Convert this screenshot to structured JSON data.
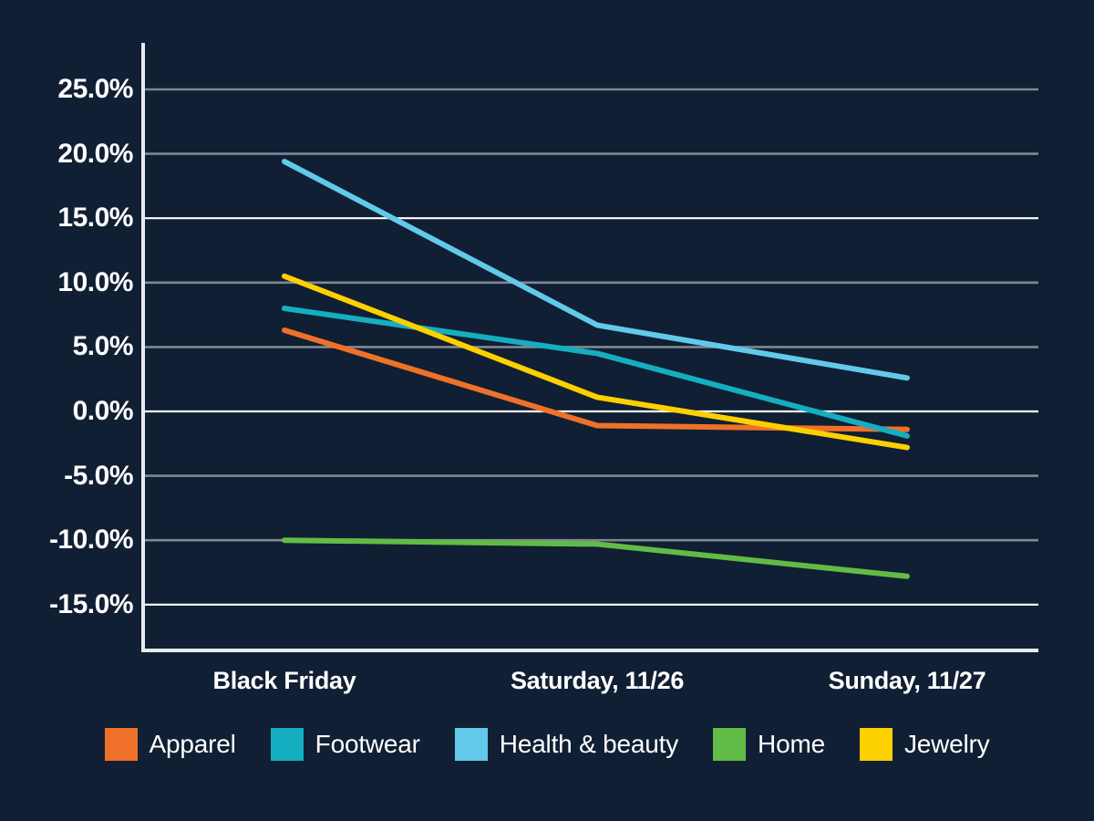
{
  "background_color": "#101f33",
  "axis": {
    "spine_color": "#e8eaed",
    "gridline_color": "#7e8893",
    "gridline_color_major": "#ffffff",
    "tick_text_color": "#ffffff"
  },
  "chart_data": {
    "type": "line",
    "title": "",
    "subtitle": "",
    "xlabel": "",
    "ylabel": "",
    "categories": [
      "Black Friday",
      "Saturday, 11/26",
      "Sunday, 11/27"
    ],
    "ylim": [
      -17.5,
      27.0
    ],
    "yticks": [
      25.0,
      20.0,
      15.0,
      10.0,
      5.0,
      0.0,
      -5.0,
      -10.0,
      -15.0
    ],
    "ytick_labels": [
      "25.0%",
      "20.0%",
      "15.0%",
      "10.0%",
      "5.0%",
      "0.0%",
      "-5.0%",
      "-10.0%",
      "-15.0%"
    ],
    "grid": true,
    "grid_axis": "y",
    "legend_position": "bottom",
    "value_format": "percent",
    "series": [
      {
        "name": "Apparel",
        "color": "#ef7129",
        "values": [
          6.3,
          -1.1,
          -1.4
        ]
      },
      {
        "name": "Footwear",
        "color": "#15aec0",
        "values": [
          8.0,
          4.5,
          -1.9
        ]
      },
      {
        "name": "Health & beauty",
        "color": "#62c9ea",
        "values": [
          19.4,
          6.7,
          2.6
        ]
      },
      {
        "name": "Home",
        "color": "#62bb46",
        "values": [
          -10.0,
          -10.3,
          -12.8
        ]
      },
      {
        "name": "Jewelry",
        "color": "#fdd000",
        "values": [
          10.5,
          1.1,
          -2.8
        ]
      }
    ]
  },
  "legend": {
    "items": [
      {
        "label": "Apparel",
        "color": "#ef7129"
      },
      {
        "label": "Footwear",
        "color": "#15aec0"
      },
      {
        "label": "Health & beauty",
        "color": "#62c9ea"
      },
      {
        "label": "Home",
        "color": "#62bb46"
      },
      {
        "label": "Jewelry",
        "color": "#fdd000"
      }
    ]
  }
}
